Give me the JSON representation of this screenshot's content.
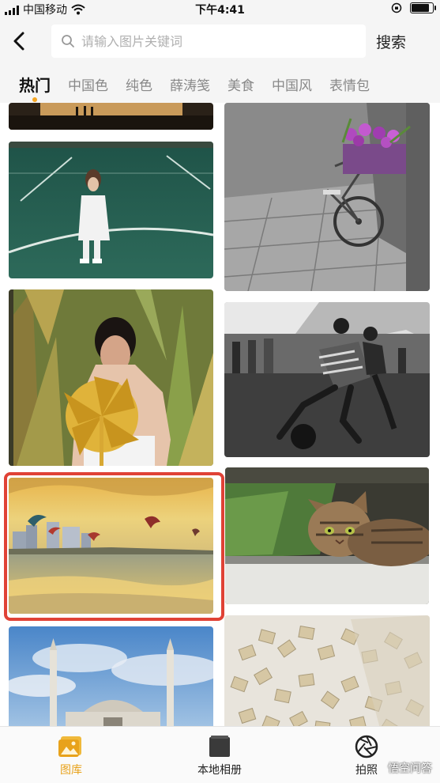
{
  "status_bar": {
    "carrier": "中国移动",
    "time": "下午4:41"
  },
  "header": {
    "search_placeholder": "请输入图片关键词",
    "search_button": "搜索"
  },
  "tabs": [
    {
      "label": "热门",
      "active": true
    },
    {
      "label": "中国色",
      "active": false
    },
    {
      "label": "纯色",
      "active": false
    },
    {
      "label": "薛涛笺",
      "active": false
    },
    {
      "label": "美食",
      "active": false
    },
    {
      "label": "中国风",
      "active": false
    },
    {
      "label": "表情包",
      "active": false
    }
  ],
  "grid": {
    "highlighted_tile": "beach-kites",
    "tiles": [
      {
        "id": "sunset-silhouettes",
        "column": "left"
      },
      {
        "id": "girl-on-court",
        "column": "left"
      },
      {
        "id": "woman-with-pinwheel",
        "column": "left"
      },
      {
        "id": "beach-kites",
        "column": "left"
      },
      {
        "id": "mosque",
        "column": "left"
      },
      {
        "id": "bicycle-flowers",
        "column": "right"
      },
      {
        "id": "kids-playing-bw",
        "column": "right"
      },
      {
        "id": "cat-under-table",
        "column": "right"
      },
      {
        "id": "letter-tiles",
        "column": "right"
      }
    ]
  },
  "bottom_nav": {
    "items": [
      {
        "label": "图库",
        "icon": "gallery-icon",
        "active": true
      },
      {
        "label": "本地相册",
        "icon": "album-icon",
        "active": false
      },
      {
        "label": "拍照",
        "icon": "camera-aperture-icon",
        "active": false
      }
    ],
    "watermark": "悟空问答"
  },
  "colors": {
    "accent": "#e8a21b",
    "highlight_border": "#e04236",
    "tab_dot": "#f5a623"
  }
}
